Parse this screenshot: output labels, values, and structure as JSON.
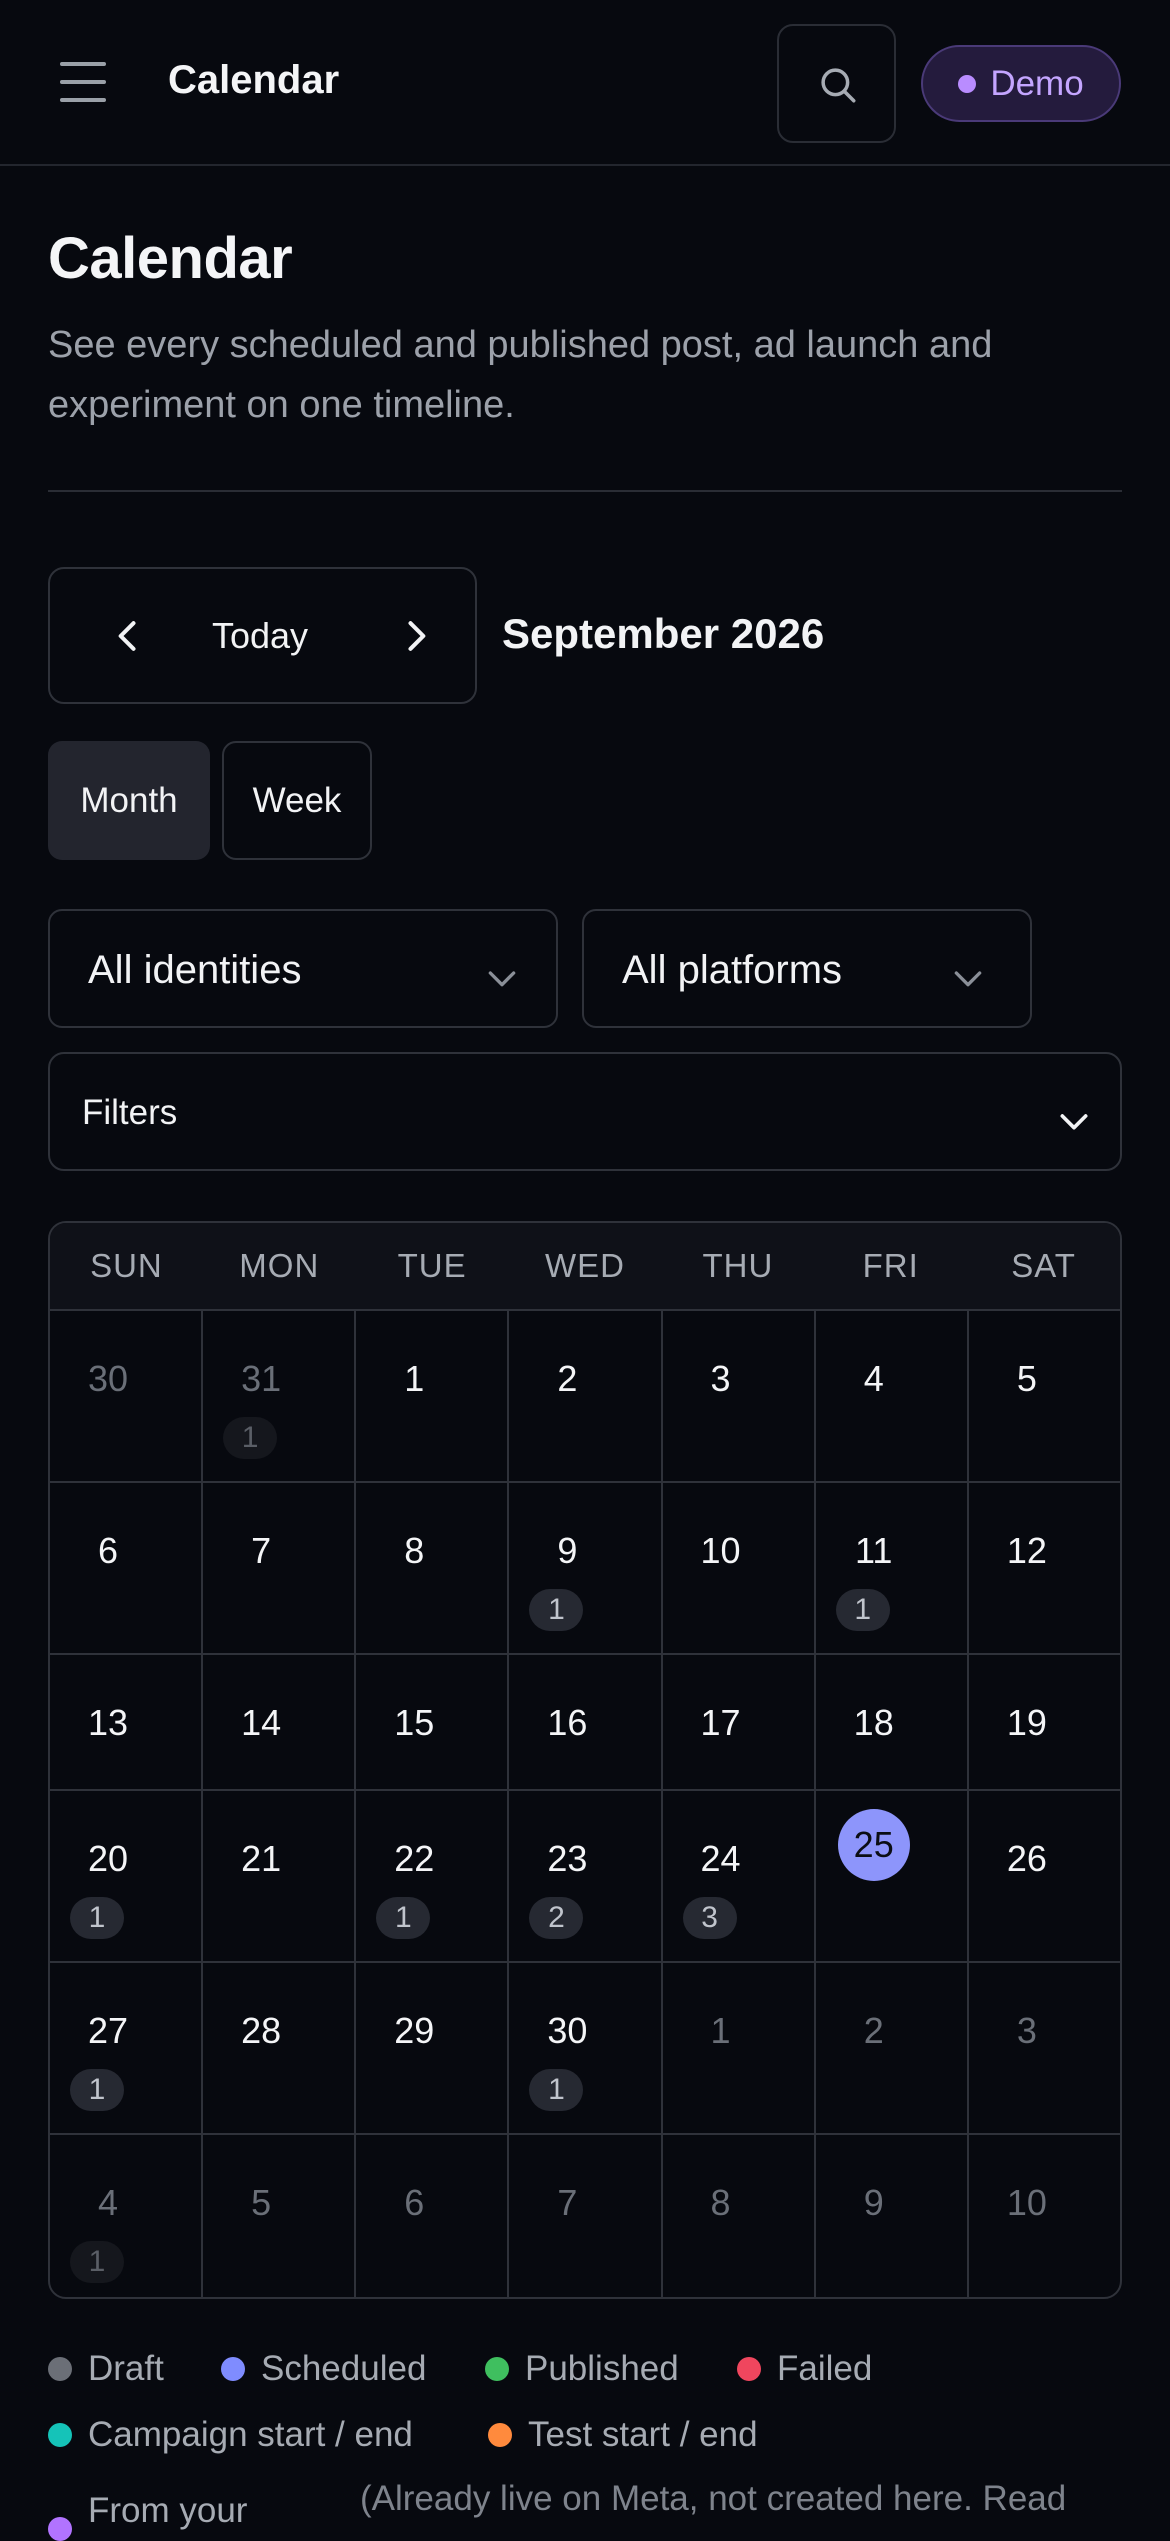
{
  "header": {
    "title": "Calendar",
    "demo_label": "Demo"
  },
  "page": {
    "title": "Calendar",
    "subtitle": "See every scheduled and published post, ad launch and experiment on one timeline."
  },
  "nav": {
    "today_label": "Today",
    "month_label": "September 2026"
  },
  "views": {
    "month_label": "Month",
    "week_label": "Week",
    "active": "Month"
  },
  "selects": {
    "identities": "All identities",
    "platforms": "All platforms"
  },
  "filters": {
    "label": "Filters"
  },
  "calendar": {
    "weekdays": [
      "SUN",
      "MON",
      "TUE",
      "WED",
      "THU",
      "FRI",
      "SAT"
    ],
    "today": "25",
    "weeks": [
      [
        {
          "day": "30",
          "out": true
        },
        {
          "day": "31",
          "out": true,
          "count": "1"
        },
        {
          "day": "1"
        },
        {
          "day": "2"
        },
        {
          "day": "3"
        },
        {
          "day": "4"
        },
        {
          "day": "5"
        }
      ],
      [
        {
          "day": "6"
        },
        {
          "day": "7"
        },
        {
          "day": "8"
        },
        {
          "day": "9",
          "count": "1"
        },
        {
          "day": "10"
        },
        {
          "day": "11",
          "count": "1"
        },
        {
          "day": "12"
        }
      ],
      [
        {
          "day": "13"
        },
        {
          "day": "14"
        },
        {
          "day": "15"
        },
        {
          "day": "16"
        },
        {
          "day": "17"
        },
        {
          "day": "18"
        },
        {
          "day": "19"
        }
      ],
      [
        {
          "day": "20",
          "count": "1"
        },
        {
          "day": "21"
        },
        {
          "day": "22",
          "count": "1"
        },
        {
          "day": "23",
          "count": "2"
        },
        {
          "day": "24",
          "count": "3"
        },
        {
          "day": "25",
          "today": true
        },
        {
          "day": "26"
        }
      ],
      [
        {
          "day": "27",
          "count": "1"
        },
        {
          "day": "28"
        },
        {
          "day": "29"
        },
        {
          "day": "30",
          "count": "1"
        },
        {
          "day": "1",
          "out": true
        },
        {
          "day": "2",
          "out": true
        },
        {
          "day": "3",
          "out": true
        }
      ],
      [
        {
          "day": "4",
          "out": true,
          "count": "1"
        },
        {
          "day": "5",
          "out": true
        },
        {
          "day": "6",
          "out": true
        },
        {
          "day": "7",
          "out": true
        },
        {
          "day": "8",
          "out": true
        },
        {
          "day": "9",
          "out": true
        },
        {
          "day": "10",
          "out": true
        }
      ]
    ]
  },
  "legend": {
    "draft": {
      "label": "Draft",
      "color": "#6b6f77"
    },
    "scheduled": {
      "label": "Scheduled",
      "color": "#7f8cff"
    },
    "published": {
      "label": "Published",
      "color": "#3fbf5f"
    },
    "failed": {
      "label": "Failed",
      "color": "#f0465e"
    },
    "campaign": {
      "label": "Campaign start / end",
      "color": "#15c3b8"
    },
    "test": {
      "label": "Test start / end",
      "color": "#ff8a3d"
    },
    "external": {
      "label": "From your",
      "color": "#b173ff"
    },
    "note": "(Already live on Meta, not created here. Read"
  },
  "colors": {
    "accent": "#8d95fb",
    "demo_pill_text": "#c4a5ff",
    "background": "#07090f"
  }
}
